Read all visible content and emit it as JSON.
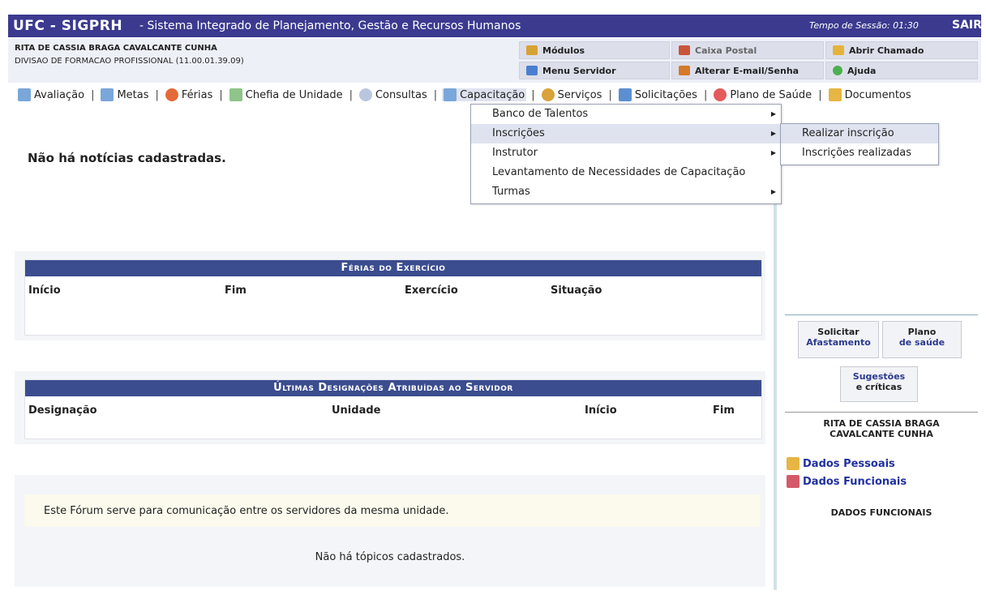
{
  "header": {
    "app": "UFC - SIGPRH",
    "subtitle": "- Sistema Integrado de Planejamento, Gestão e Recursos Humanos",
    "session_label": "Tempo de Sessão: 01:30",
    "logout": "SAIR",
    "color": "#3b3a8f"
  },
  "user": {
    "name": "RITA DE CASSIA BRAGA CAVALCANTE CUNHA",
    "unit": "DIVISAO DE FORMACAO PROFISSIONAL (11.00.01.39.09)"
  },
  "quick": {
    "modulos": "Módulos",
    "caixa": "Caixa Postal",
    "chamado": "Abrir Chamado",
    "menu_servidor": "Menu Servidor",
    "alterar": "Alterar E-mail/Senha",
    "ajuda": "Ajuda"
  },
  "menu": {
    "avaliacao": "Avaliação",
    "metas": "Metas",
    "ferias": "Férias",
    "chefia": "Chefia de Unidade",
    "consultas": "Consultas",
    "capacitacao": "Capacitação",
    "servicos": "Serviços",
    "solicitacoes": "Solicitações",
    "plano": "Plano de Saúde",
    "documentos": "Documentos",
    "sep": "|"
  },
  "dropdown": {
    "items": [
      "Banco de Talentos",
      "Inscrições",
      "Instrutor",
      "Levantamento de Necessidades de Capacitação",
      "Turmas"
    ],
    "submenu": [
      "Realizar inscrição",
      "Inscrições realizadas"
    ]
  },
  "noticias": "Não há notícias cadastradas.",
  "ferias": {
    "title": "Férias do Exercício",
    "cols": [
      "Início",
      "Fim",
      "Exercício",
      "Situação"
    ]
  },
  "designacoes": {
    "title": "Últimas Designações Atribuídas ao Servidor",
    "cols": [
      "Designação",
      "Unidade",
      "Início",
      "Fim"
    ]
  },
  "forum": {
    "desc": "Este Fórum serve para comunicação entre os servidores da mesma unidade.",
    "empty": "Não há tópicos cadastrados."
  },
  "sidebar": {
    "solicitar_1": "Solicitar",
    "solicitar_2": "Afastamento",
    "plano_1": "Plano",
    "plano_2": "de saúde",
    "sugestoes_1": "Sugestões",
    "sugestoes_2": "e críticas",
    "name_1": "RITA DE CASSIA BRAGA",
    "name_2": "CAVALCANTE CUNHA",
    "dados_pessoais": "Dados Pessoais",
    "dados_funcionais": "Dados Funcionais",
    "dados_funcionais_title": "DADOS FUNCIONAIS"
  }
}
